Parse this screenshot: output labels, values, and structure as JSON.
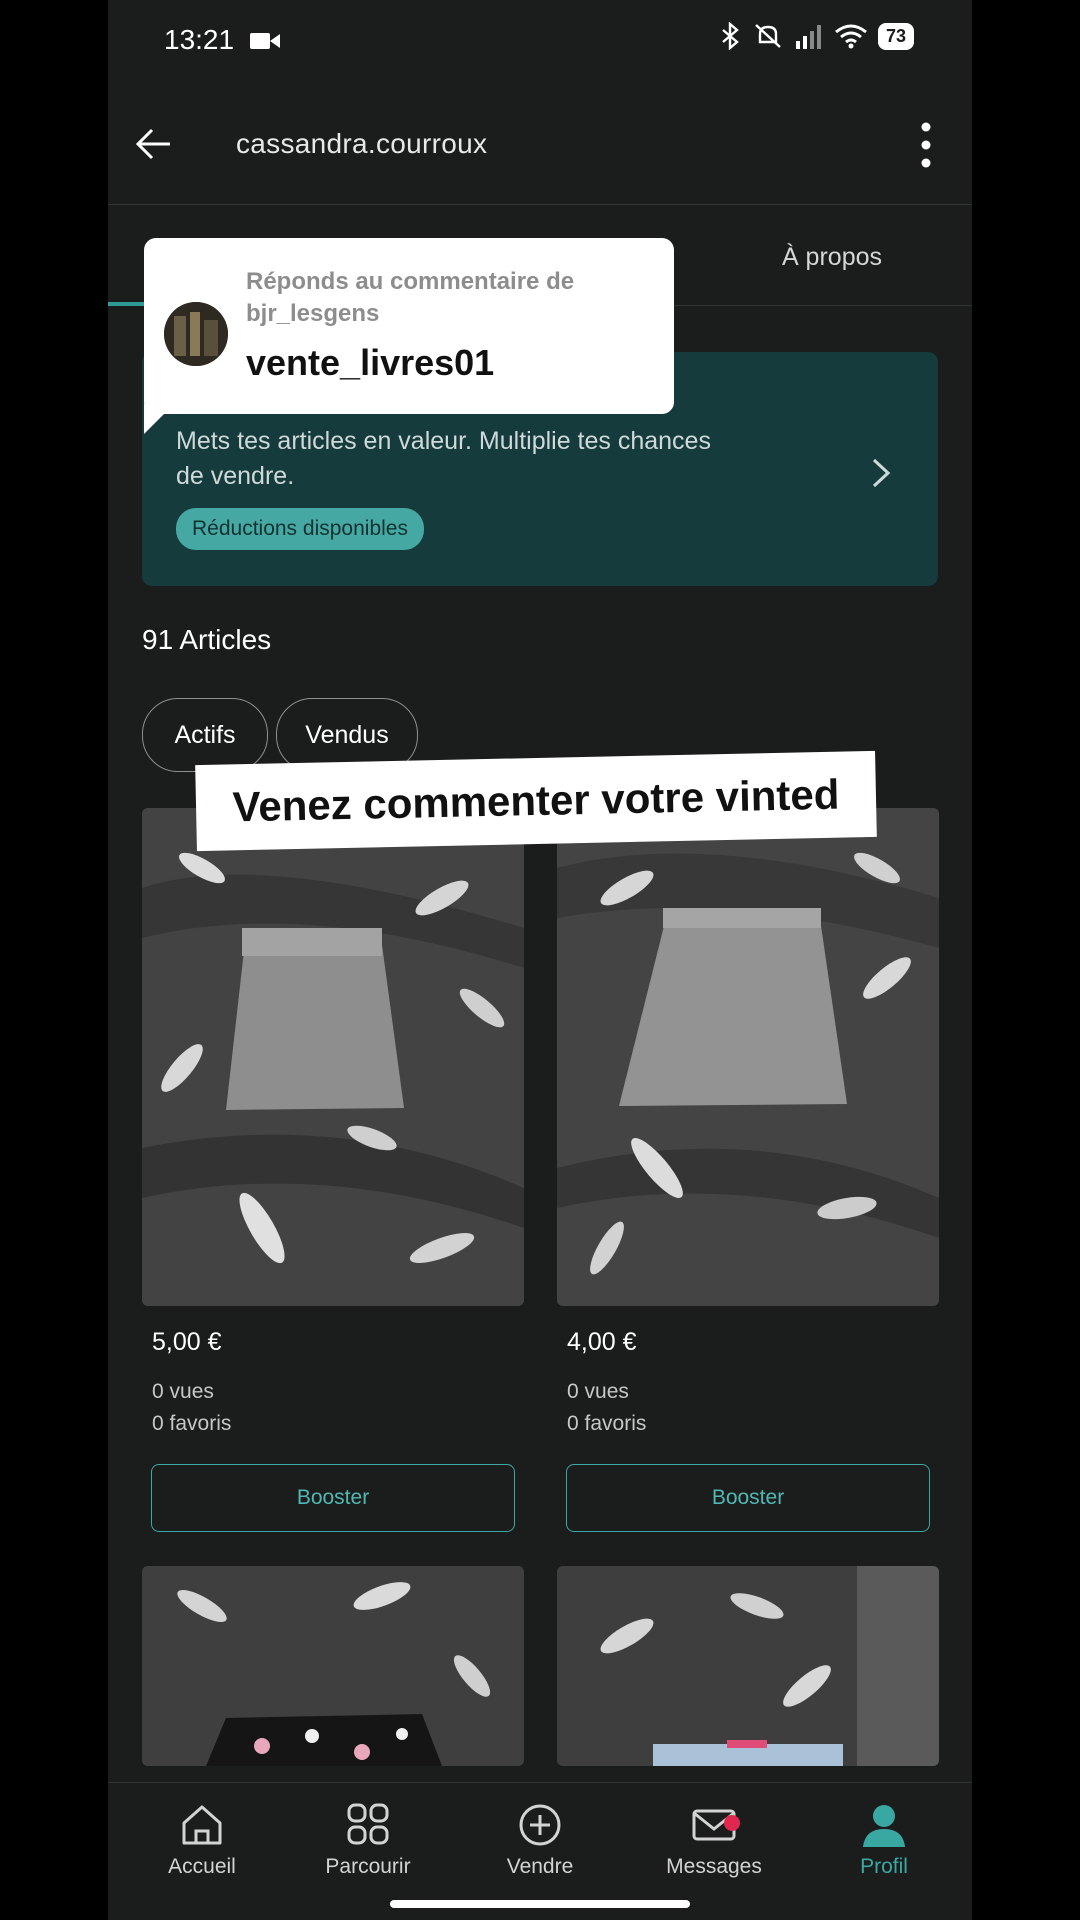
{
  "status_bar": {
    "time": "13:21",
    "battery": "73"
  },
  "header": {
    "username": "cassandra.courroux"
  },
  "tabs": {
    "about_label": "À propos"
  },
  "tooltip": {
    "line1": "Réponds au commentaire de bjr_lesgens",
    "username": "vente_livres01"
  },
  "promo": {
    "text": "Mets tes articles en valeur. Multiplie tes chances de vendre.",
    "pill": "Réductions disponibles"
  },
  "articles": {
    "count_label": "91 Articles",
    "filters": [
      "Actifs",
      "Vendus"
    ],
    "caption": "Venez commenter votre vinted",
    "items": [
      {
        "price": "5,00 €",
        "views": "0 vues",
        "favorites": "0 favoris",
        "button": "Booster"
      },
      {
        "price": "4,00 €",
        "views": "0 vues",
        "favorites": "0 favoris",
        "button": "Booster"
      }
    ]
  },
  "nav": {
    "items": [
      "Accueil",
      "Parcourir",
      "Vendre",
      "Messages",
      "Profil"
    ],
    "active": "Profil",
    "accent": "#3aa8a2"
  }
}
